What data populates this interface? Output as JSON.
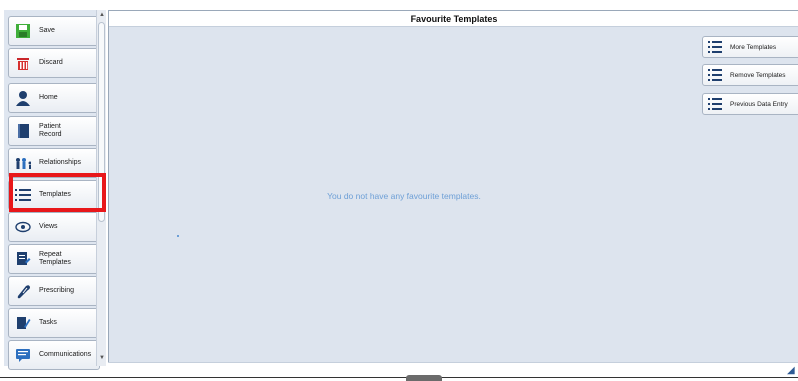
{
  "sidebar": {
    "items": [
      {
        "label": "Save",
        "icon": "save-icon"
      },
      {
        "label": "Discard",
        "icon": "discard-icon"
      },
      {
        "label": "Home",
        "icon": "home-icon"
      },
      {
        "label": "Patient\nRecord",
        "icon": "patient-record-icon"
      },
      {
        "label": "Relationships",
        "icon": "relationships-icon"
      },
      {
        "label": "Templates",
        "icon": "templates-icon"
      },
      {
        "label": "Views",
        "icon": "views-icon"
      },
      {
        "label": "Repeat\nTemplates",
        "icon": "repeat-templates-icon"
      },
      {
        "label": "Prescribing",
        "icon": "prescribing-icon"
      },
      {
        "label": "Tasks",
        "icon": "tasks-icon"
      },
      {
        "label": "Communications",
        "icon": "communications-icon"
      }
    ],
    "highlighted": "Templates"
  },
  "main": {
    "title": "Favourite Templates",
    "empty_message": "You do not have any favourite templates."
  },
  "actions": {
    "more_templates": "More Templates",
    "remove_templates": "Remove Templates",
    "previous_data_entry": "Previous Data Entry"
  },
  "colors": {
    "accent": "#2f5b95",
    "highlight": "#e8171a",
    "panel": "#dde4ee",
    "message": "#6d9fd6"
  }
}
